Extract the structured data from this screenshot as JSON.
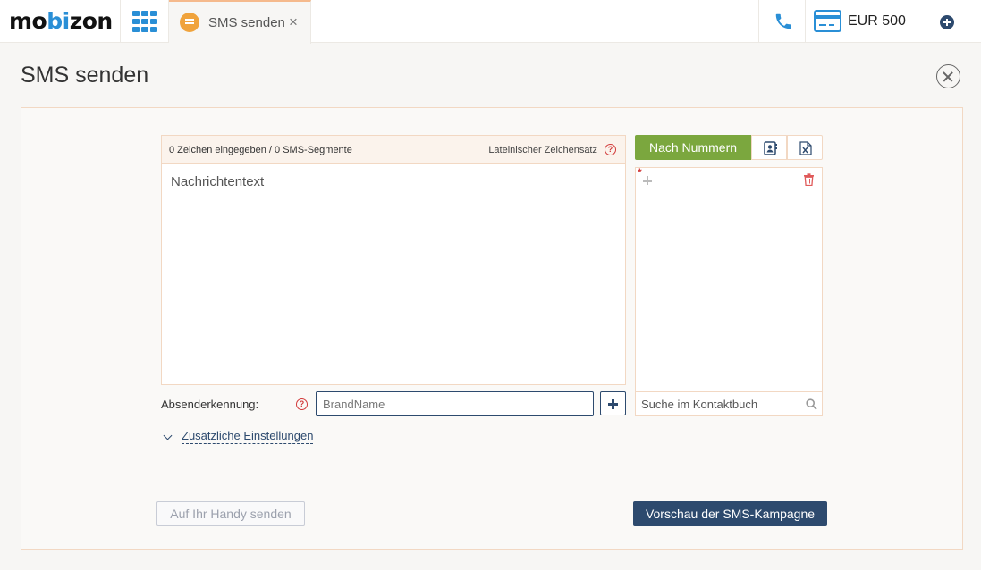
{
  "app": {
    "logo_left": "mo",
    "logo_accent": "bi",
    "logo_right": "zon"
  },
  "topbar": {
    "tab_label": "SMS senden",
    "tab_close": "×",
    "balance": "EUR 500"
  },
  "page": {
    "title": "SMS senden"
  },
  "message": {
    "counter": "0 Zeichen eingegeben / 0 SMS-Segmente",
    "charset": "Lateinischer Zeichensatz",
    "placeholder": "Nachrichtentext",
    "help": "?"
  },
  "sender": {
    "label": "Absenderkennung:",
    "placeholder": "BrandName",
    "help": "?"
  },
  "extra_settings": {
    "label": "Zusätzliche Einstellungen"
  },
  "recipients": {
    "active_tab": "Nach Nummern",
    "required_mark": "*",
    "search_placeholder": "Suche im Kontaktbuch"
  },
  "buttons": {
    "send_to_phone": "Auf Ihr Handy senden",
    "preview": "Vorschau der SMS-Kampagne"
  },
  "colors": {
    "brand_blue": "#2a8fd6",
    "navy": "#2d4a6e",
    "green": "#7ba73e",
    "peach_border": "#f2d8c3",
    "red": "#d23a3a"
  }
}
